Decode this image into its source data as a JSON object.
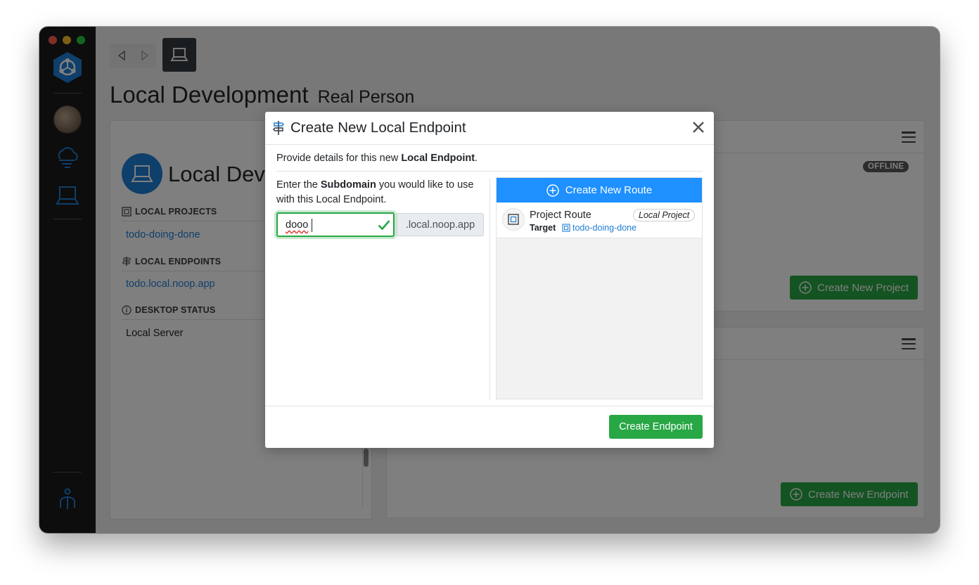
{
  "page": {
    "title": "Local Development",
    "subtitle": "Real Person"
  },
  "left_card": {
    "title": "Local Dev",
    "local_projects_header": "LOCAL PROJECTS",
    "project_link": "todo-doing-done",
    "local_endpoints_header": "LOCAL ENDPOINTS",
    "endpoint_link": "todo.local.noop.app",
    "desktop_status_header": "DESKTOP STATUS",
    "desktop_status_item": "Local Server"
  },
  "right_cards": {
    "status_badge": "OFFLINE",
    "create_project_label": "Create New Project",
    "create_endpoint_label": "Create New Endpoint"
  },
  "modal": {
    "title": "Create New Local Endpoint",
    "desc_prefix": "Provide details for this new ",
    "desc_bold": "Local Endpoint",
    "desc_suffix": ".",
    "enter_prefix": "Enter the ",
    "enter_bold": "Subdomain",
    "enter_suffix": " you would like to use with this Local Endpoint.",
    "subdomain_value": "dooo",
    "domain_suffix": ".local.noop.app",
    "create_route_label": "Create New Route",
    "route_name": "Project Route",
    "route_badge": "Local Project",
    "route_target_label": "Target",
    "route_target_value": "todo-doing-done",
    "submit_label": "Create Endpoint"
  },
  "colors": {
    "accent_blue": "#1e90ff",
    "link_blue": "#1f7fd6",
    "success_green": "#28a745",
    "sidebar_bg": "#1a1a1a"
  },
  "icons": [
    "app-logo-icon",
    "avatar",
    "cloud-icon",
    "laptop-icon",
    "user-icon",
    "back-icon",
    "forward-icon",
    "signpost-icon",
    "close-icon",
    "check-icon",
    "plus-circle-icon",
    "project-icon",
    "info-icon",
    "menu-icon"
  ]
}
